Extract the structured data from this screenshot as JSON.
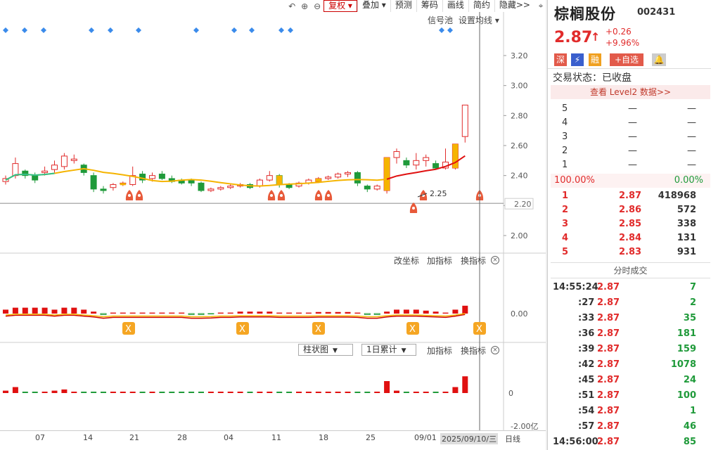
{
  "toolbar": {
    "undo_icon": "undo-icon",
    "zoom_in_icon": "zoom-in-icon",
    "zoom_out_icon": "zoom-out-icon",
    "buttons": [
      "复权",
      "叠加",
      "预测",
      "筹码",
      "画线",
      "简约",
      "隐藏>>"
    ],
    "fuquan_label": "复权",
    "diejia_label": "叠加"
  },
  "chart": {
    "signal_pool": "信号池",
    "set_ma": "设置均线",
    "price_ticks": [
      "3.20",
      "3.00",
      "2.80",
      "2.60",
      "2.40",
      "2.20",
      "2.00"
    ],
    "last_price_tag": "2.20",
    "low_marker": "2.25",
    "indicator_buttons": [
      "改坐标",
      "加指标",
      "换指标"
    ],
    "indicator_zero": "0.00",
    "volume_select": "柱状图",
    "volume_period": "1日累计",
    "volume_buttons": [
      "加指标",
      "换指标"
    ],
    "volume_zero": "0",
    "volume_min": "-2.00亿"
  },
  "xaxis": {
    "labels": [
      "07",
      "14",
      "21",
      "28",
      "04",
      "11",
      "18",
      "25",
      "09/01"
    ],
    "cursor_date": "2025/09/10/三",
    "period": "日线"
  },
  "panel": {
    "name": "棕榈股份",
    "code": "002431",
    "price": "2.87",
    "change": "+0.26",
    "change_pct": "+9.96%",
    "badges": [
      "深",
      "⚡",
      "融",
      "+自选",
      "🔔"
    ],
    "status_label": "交易状态：已收盘",
    "level2_link": "查看 Level2 数据>>",
    "sell_book": [
      {
        "level": "5",
        "price": "—",
        "vol": "—"
      },
      {
        "level": "4",
        "price": "—",
        "vol": "—"
      },
      {
        "level": "3",
        "price": "—",
        "vol": "—"
      },
      {
        "level": "2",
        "price": "—",
        "vol": "—"
      },
      {
        "level": "1",
        "price": "—",
        "vol": "—"
      }
    ],
    "ratio_left": "100.00%",
    "ratio_right": "0.00%",
    "buy_book": [
      {
        "level": "1",
        "price": "2.87",
        "vol": "418968"
      },
      {
        "level": "2",
        "price": "2.86",
        "vol": "572"
      },
      {
        "level": "3",
        "price": "2.85",
        "vol": "338"
      },
      {
        "level": "4",
        "price": "2.84",
        "vol": "131"
      },
      {
        "level": "5",
        "price": "2.83",
        "vol": "931"
      }
    ],
    "ticks_title": "分时成交",
    "ticks": [
      {
        "time": "14:55:24",
        "price": "2.87",
        "vol": "7",
        "dir": "green"
      },
      {
        "time": ":27",
        "price": "2.87",
        "vol": "2",
        "dir": "green"
      },
      {
        "time": ":33",
        "price": "2.87",
        "vol": "35",
        "dir": "green"
      },
      {
        "time": ":36",
        "price": "2.87",
        "vol": "181",
        "dir": "green"
      },
      {
        "time": ":39",
        "price": "2.87",
        "vol": "159",
        "dir": "green"
      },
      {
        "time": ":42",
        "price": "2.87",
        "vol": "1078",
        "dir": "green"
      },
      {
        "time": ":45",
        "price": "2.87",
        "vol": "24",
        "dir": "green"
      },
      {
        "time": ":51",
        "price": "2.87",
        "vol": "100",
        "dir": "green"
      },
      {
        "time": ":54",
        "price": "2.87",
        "vol": "1",
        "dir": "green"
      },
      {
        "time": ":57",
        "price": "2.87",
        "vol": "46",
        "dir": "green"
      },
      {
        "time": "14:56:00",
        "price": "2.87",
        "vol": "85",
        "dir": "green"
      }
    ]
  },
  "colors": {
    "up": "#e12b2b",
    "down": "#1f9a3a",
    "ma": "#f5b400",
    "signal": "#3b8beb"
  },
  "chart_data": [
    {
      "type": "candlestick",
      "title": "",
      "ylim": [
        2.0,
        3.2
      ],
      "candles": [
        {
          "o": 2.36,
          "c": 2.38,
          "h": 2.4,
          "l": 2.34
        },
        {
          "o": 2.4,
          "c": 2.48,
          "h": 2.52,
          "l": 2.38
        },
        {
          "o": 2.43,
          "c": 2.4,
          "h": 2.44,
          "l": 2.38
        },
        {
          "o": 2.4,
          "c": 2.37,
          "h": 2.42,
          "l": 2.35
        },
        {
          "o": 2.42,
          "c": 2.43,
          "h": 2.46,
          "l": 2.4
        },
        {
          "o": 2.44,
          "c": 2.47,
          "h": 2.5,
          "l": 2.42
        },
        {
          "o": 2.46,
          "c": 2.53,
          "h": 2.55,
          "l": 2.44
        },
        {
          "o": 2.5,
          "c": 2.51,
          "h": 2.54,
          "l": 2.48
        },
        {
          "o": 2.47,
          "c": 2.42,
          "h": 2.48,
          "l": 2.4
        },
        {
          "o": 2.4,
          "c": 2.31,
          "h": 2.42,
          "l": 2.29
        },
        {
          "o": 2.31,
          "c": 2.3,
          "h": 2.33,
          "l": 2.28
        },
        {
          "o": 2.32,
          "c": 2.34,
          "h": 2.35,
          "l": 2.3
        },
        {
          "o": 2.35,
          "c": 2.35,
          "h": 2.36,
          "l": 2.33
        },
        {
          "o": 2.34,
          "c": 2.4,
          "h": 2.46,
          "l": 2.33
        },
        {
          "o": 2.41,
          "c": 2.37,
          "h": 2.43,
          "l": 2.35
        },
        {
          "o": 2.38,
          "c": 2.4,
          "h": 2.42,
          "l": 2.36
        },
        {
          "o": 2.41,
          "c": 2.38,
          "h": 2.43,
          "l": 2.37
        },
        {
          "o": 2.38,
          "c": 2.36,
          "h": 2.4,
          "l": 2.35
        },
        {
          "o": 2.37,
          "c": 2.35,
          "h": 2.38,
          "l": 2.34
        },
        {
          "o": 2.37,
          "c": 2.35,
          "h": 2.38,
          "l": 2.33
        },
        {
          "o": 2.35,
          "c": 2.3,
          "h": 2.36,
          "l": 2.29
        },
        {
          "o": 2.3,
          "c": 2.31,
          "h": 2.32,
          "l": 2.29
        },
        {
          "o": 2.31,
          "c": 2.32,
          "h": 2.33,
          "l": 2.3
        },
        {
          "o": 2.32,
          "c": 2.33,
          "h": 2.34,
          "l": 2.31
        },
        {
          "o": 2.33,
          "c": 2.34,
          "h": 2.35,
          "l": 2.32
        },
        {
          "o": 2.34,
          "c": 2.32,
          "h": 2.35,
          "l": 2.31
        },
        {
          "o": 2.33,
          "c": 2.37,
          "h": 2.38,
          "l": 2.32
        },
        {
          "o": 2.37,
          "c": 2.4,
          "h": 2.43,
          "l": 2.36
        },
        {
          "o": 2.4,
          "c": 2.34,
          "h": 2.41,
          "l": 2.32
        },
        {
          "o": 2.34,
          "c": 2.32,
          "h": 2.35,
          "l": 2.31
        },
        {
          "o": 2.33,
          "c": 2.35,
          "h": 2.36,
          "l": 2.32
        },
        {
          "o": 2.35,
          "c": 2.37,
          "h": 2.38,
          "l": 2.34
        },
        {
          "o": 2.36,
          "c": 2.38,
          "h": 2.39,
          "l": 2.35
        },
        {
          "o": 2.38,
          "c": 2.39,
          "h": 2.4,
          "l": 2.37
        },
        {
          "o": 2.39,
          "c": 2.41,
          "h": 2.42,
          "l": 2.38
        },
        {
          "o": 2.41,
          "c": 2.42,
          "h": 2.43,
          "l": 2.39
        },
        {
          "o": 2.42,
          "c": 2.35,
          "h": 2.43,
          "l": 2.33
        },
        {
          "o": 2.33,
          "c": 2.31,
          "h": 2.34,
          "l": 2.29
        },
        {
          "o": 2.31,
          "c": 2.33,
          "h": 2.34,
          "l": 2.3
        },
        {
          "o": 2.3,
          "c": 2.52,
          "h": 2.52,
          "l": 2.28
        },
        {
          "o": 2.52,
          "c": 2.56,
          "h": 2.58,
          "l": 2.48
        },
        {
          "o": 2.5,
          "c": 2.47,
          "h": 2.52,
          "l": 2.45
        },
        {
          "o": 2.47,
          "c": 2.5,
          "h": 2.55,
          "l": 2.44
        },
        {
          "o": 2.5,
          "c": 2.52,
          "h": 2.54,
          "l": 2.46
        },
        {
          "o": 2.48,
          "c": 2.45,
          "h": 2.5,
          "l": 2.44
        },
        {
          "o": 2.45,
          "c": 2.49,
          "h": 2.58,
          "l": 2.44
        },
        {
          "o": 2.45,
          "c": 2.61,
          "h": 2.61,
          "l": 2.44
        },
        {
          "o": 2.66,
          "c": 2.87,
          "h": 2.87,
          "l": 2.62
        }
      ]
    },
    {
      "type": "bar",
      "title": "",
      "values": [
        0.2,
        0.3,
        0.3,
        0.3,
        0.3,
        0.2,
        0.3,
        0.3,
        0.2,
        0.1,
        -0.05,
        0.05,
        0.05,
        0.05,
        0.05,
        0.05,
        0.05,
        0.05,
        0.05,
        -0.05,
        -0.05,
        -0.02,
        0.05,
        0.05,
        0.1,
        0.1,
        0.1,
        0.1,
        0.05,
        0.05,
        0.05,
        0.05,
        0.08,
        0.08,
        0.08,
        0.08,
        0.05,
        -0.05,
        -0.05,
        0.1,
        0.2,
        0.2,
        0.2,
        0.15,
        0.1,
        0.05,
        0.2,
        0.4
      ]
    },
    {
      "type": "bar",
      "title": "",
      "values": [
        0.2,
        0.5,
        0.1,
        0.05,
        0.1,
        0.2,
        0.3,
        0.1,
        0.1,
        0.1,
        0.05,
        0.05,
        0.05,
        0.05,
        0.05,
        0.05,
        0.05,
        0.05,
        0.05,
        0.05,
        0.05,
        0.05,
        0.05,
        0.05,
        0.05,
        0.05,
        0.05,
        0.05,
        0.05,
        0.05,
        0.05,
        0.05,
        0.05,
        0.05,
        0.05,
        0.05,
        0.05,
        0.05,
        0.05,
        1.0,
        0.2,
        0.05,
        0.05,
        0.05,
        0.05,
        0.05,
        0.5,
        1.4
      ]
    }
  ]
}
